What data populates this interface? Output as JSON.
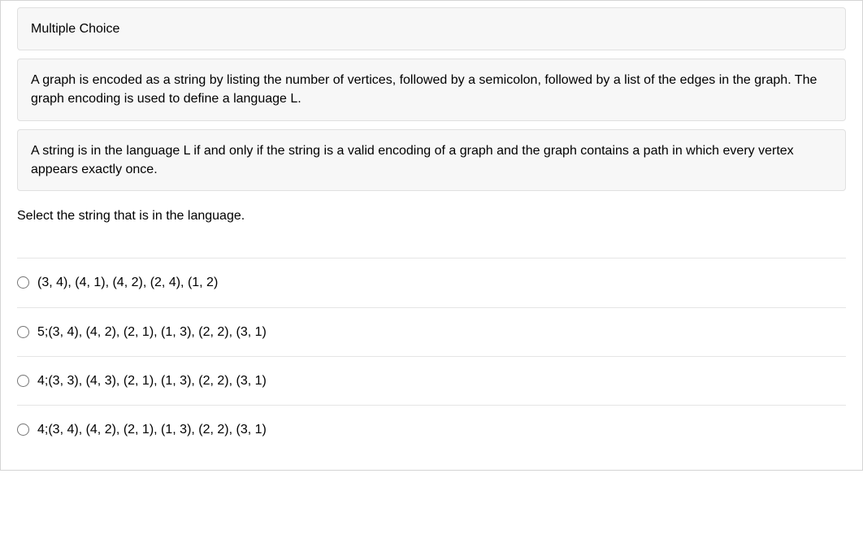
{
  "title": "Multiple Choice",
  "blocks": [
    "A graph is encoded as a string by listing the number of vertices, followed by a semicolon, followed by a list of the edges\nin the graph. The graph encoding is used to define a language L.",
    "A string is in the language L if and only if the string is a valid encoding of a graph and the graph contains a path in which\nevery vertex appears exactly once."
  ],
  "prompt": "Select the string that is in the language.",
  "options": [
    "(3, 4), (4, 1), (4, 2), (2, 4), (1, 2)",
    "5;(3, 4), (4, 2), (2, 1), (1, 3), (2, 2), (3, 1)",
    "4;(3, 3), (4, 3), (2, 1), (1, 3), (2, 2), (3, 1)",
    "4;(3, 4), (4, 2), (2, 1), (1, 3), (2, 2), (3, 1)"
  ]
}
